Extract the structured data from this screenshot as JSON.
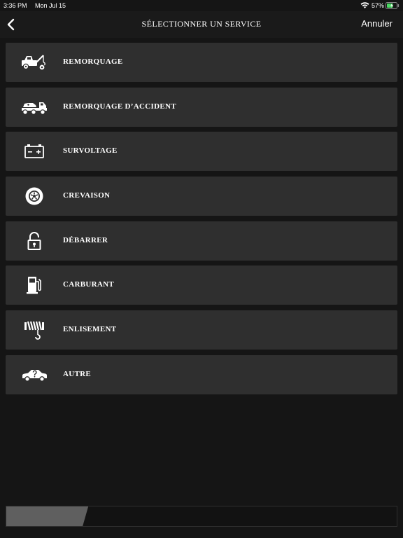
{
  "status_bar": {
    "time": "3:36 PM",
    "date": "Mon Jul 15",
    "battery_percent": "57%",
    "icons": [
      "wifi-icon",
      "battery-icon"
    ]
  },
  "nav": {
    "title": "SÉLECTIONNER UN SERVICE",
    "cancel_label": "Annuler",
    "back_icon": "chevron-left-icon"
  },
  "services": [
    {
      "label": "REMORQUAGE",
      "icon": "tow-truck-icon"
    },
    {
      "label": "REMORQUAGE D’ACCIDENT",
      "icon": "accident-tow-icon"
    },
    {
      "label": "SURVOLTAGE",
      "icon": "battery-jump-icon"
    },
    {
      "label": "CREVAISON",
      "icon": "flat-tire-icon"
    },
    {
      "label": "DÉBARRER",
      "icon": "unlock-icon"
    },
    {
      "label": "CARBURANT",
      "icon": "fuel-pump-icon"
    },
    {
      "label": "ENLISEMENT",
      "icon": "winch-icon"
    },
    {
      "label": "AUTRE",
      "icon": "car-question-icon"
    }
  ],
  "progress": {
    "fraction": 0.21
  },
  "colors": {
    "background": "#151515",
    "nav_background": "#1a1a1a",
    "item_background": "#2f2f2f",
    "progress_fill": "#5f5f5f",
    "text": "#ffffff"
  }
}
